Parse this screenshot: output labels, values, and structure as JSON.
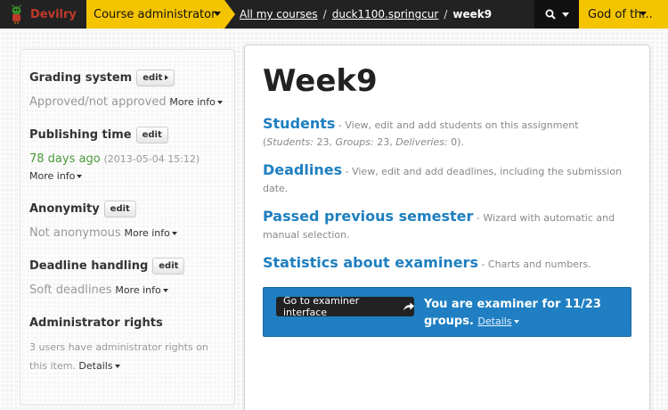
{
  "topbar": {
    "brand": "Devilry",
    "role": "Course administrator",
    "breadcrumb": [
      "All my courses",
      "duck1100.springcur"
    ],
    "breadcrumb_separator": "/",
    "current": "week9",
    "user": "God of th..."
  },
  "sidebar": {
    "grading": {
      "title": "Grading system",
      "edit": "edit",
      "value": "Approved/not approved",
      "more": "More info"
    },
    "publishing": {
      "title": "Publishing time",
      "edit": "edit",
      "relative": "78 days ago",
      "date": "(2013-05-04 15:12)",
      "more": "More info"
    },
    "anonymity": {
      "title": "Anonymity",
      "edit": "edit",
      "value": "Not anonymous",
      "more": "More info"
    },
    "deadline": {
      "title": "Deadline handling",
      "edit": "edit",
      "value": "Soft deadlines",
      "more": "More info"
    },
    "admin": {
      "title": "Administrator rights",
      "text": "3 users have administrator rights on this item.",
      "details": "Details"
    }
  },
  "main": {
    "title": "Week9",
    "students": {
      "link": "Students",
      "desc_a": " - View, edit and add students on this assignment (",
      "students_label": "Students:",
      "students_count": " 23, ",
      "groups_label": "Groups:",
      "groups_count": " 23, ",
      "deliveries_label": "Deliveries:",
      "deliveries_count": " 0)."
    },
    "deadlines": {
      "link": "Deadlines",
      "desc": " - View, edit and add deadlines, including the submission date."
    },
    "passed": {
      "link": "Passed previous semester",
      "desc": " - Wizard with automatic and manual selection."
    },
    "stats": {
      "link": "Statistics about examiners",
      "desc": " - Charts and numbers."
    },
    "examiner": {
      "button": "Go to examiner interface",
      "text": "You are examiner for 11/23 groups.",
      "details": "Details"
    }
  },
  "colors": {
    "accent_yellow": "#f5c400",
    "link_blue": "#1e7fc0",
    "box_blue": "#1f7fc2",
    "topbar": "#222222"
  }
}
